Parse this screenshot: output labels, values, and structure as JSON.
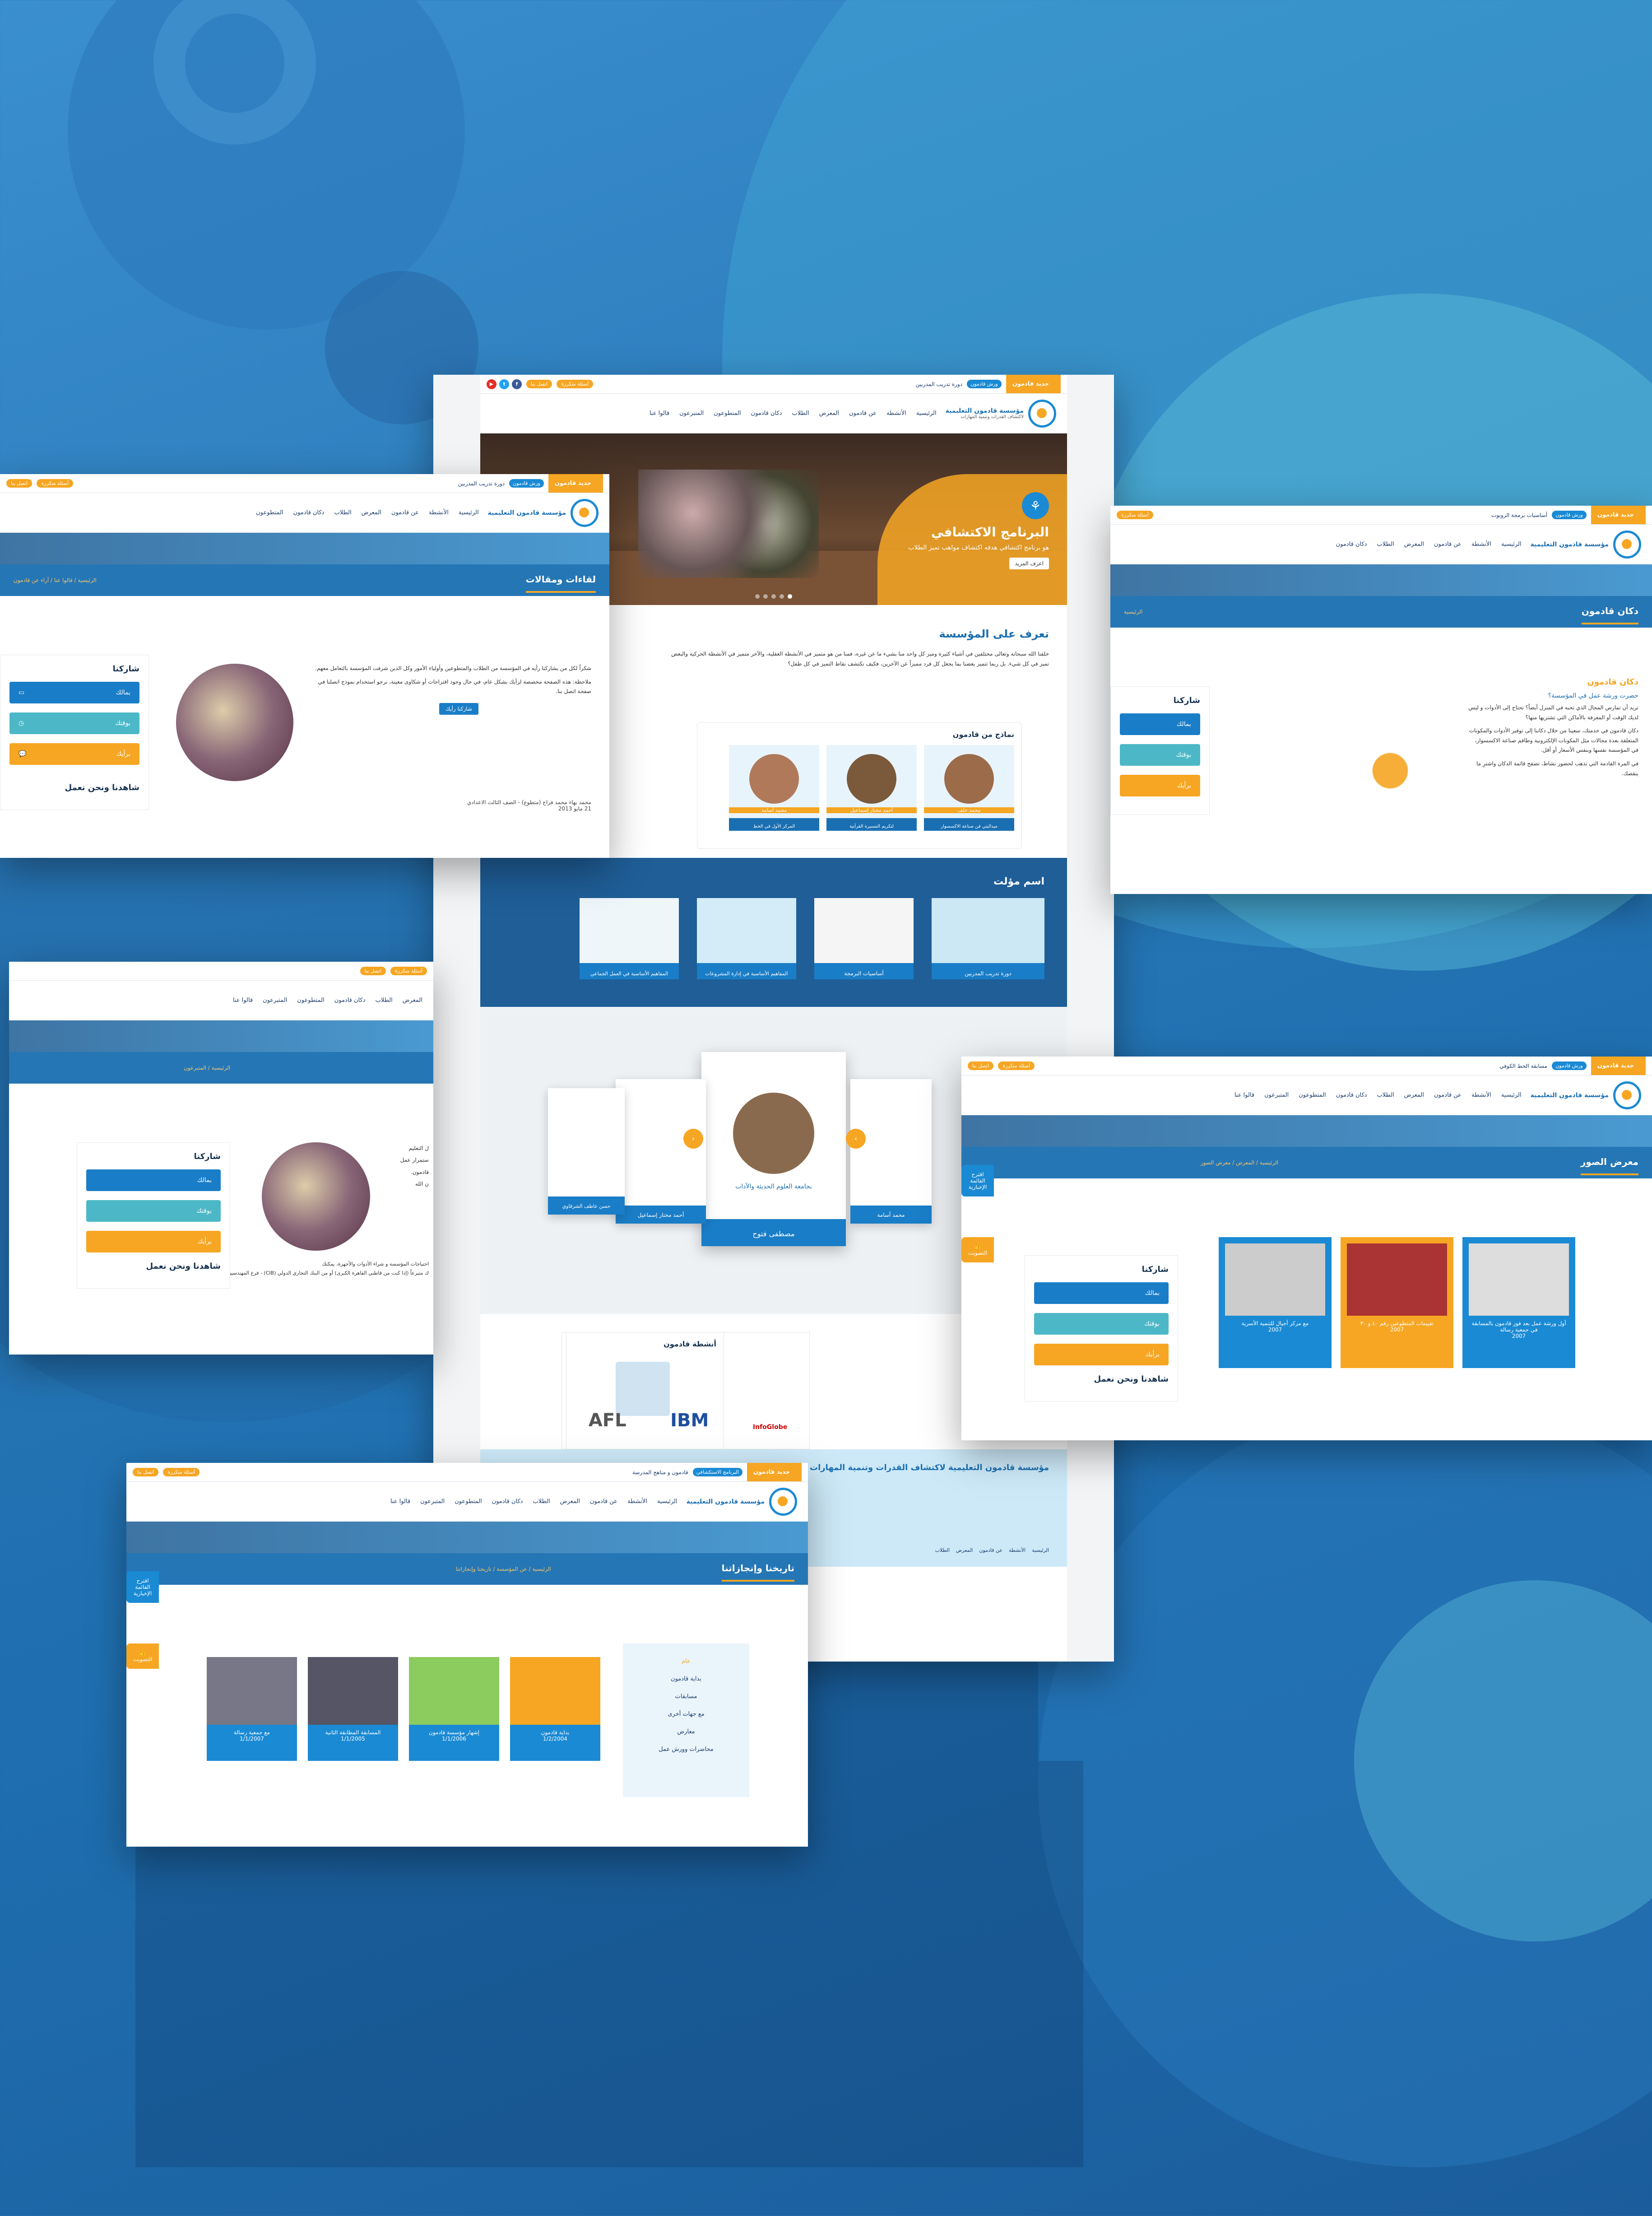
{
  "brand": {
    "name": "مؤسسة قادمون التعليمية",
    "tagline": "لاكتشاف القدرات وتنمية المهارات"
  },
  "topbar": {
    "news_label": "جديد قادمون",
    "faq_label": "أسئلة متكررة",
    "contact_label": "اتصل بنا",
    "tickers": [
      "ورش قادمون",
      "دورة تدريب المدربين",
      "أساسيات برمجة الروبوت",
      "مسابقة الخط الكوفي",
      "البرنامج الاستكشافي",
      "قادمون و مناهج المدرسة"
    ]
  },
  "menu": [
    "الرئيسية",
    "الأنشطة",
    "عن قادمون",
    "المعرض",
    "الطلاب",
    "دكان قادمون",
    "المتطوعون",
    "المتبرعون",
    "قالوا عنا"
  ],
  "hero": {
    "title": "البرنامج الاكتشافي",
    "text": "هو برنامج اكتشافي هدفه اكتشاف مواهب تميز الطلاب",
    "more": "اعرف المزيد"
  },
  "about": {
    "title": "تعرف على المؤسسة",
    "text": "خلقنا الله سبحانه وتعالى مختلفين في أشياء كثيرة وميز كل واحد منا بشيء ما عن غيره، فمنا من هو متميز في الأنشطة العقلية، والآخر متميز في الأنشطة الحركية والبعض تميز في كل شيء. بل ربما تتميز بعضنا بما يجعل كل فرد مميزاً عن الآخرين، فكيف نكتشف نقاط التميز في كل طفل؟"
  },
  "models": {
    "title": "نماذج من قادمون",
    "items": [
      {
        "name": "محمد خلف",
        "caption": "ميداليتي فن صناعة الاكسسوار"
      },
      {
        "name": "أحمد مختار إسماعيل",
        "caption": "لتكريم المسيرة القرآنية"
      },
      {
        "name": "محمد أسامة",
        "caption": "المركز الأول في الخط"
      }
    ]
  },
  "workshops": {
    "title": "اسم مؤلت",
    "items": [
      "دورة تدريب المدربين",
      "أساسيات البرمجة",
      "المفاهيم الأساسية في إدارة المشروعات",
      "المفاهيم الأساسية في العمل الجماعي"
    ]
  },
  "carousel": {
    "center_name": "مصطفى فتوح",
    "center_caption": "بجامعة العلوم الحديثة والآداب",
    "names": [
      "محمد أسامة",
      "حسن عاطف",
      "أحمد مختار إسماعيل",
      "حسن عاطف الشرقاوي"
    ]
  },
  "activities_title": "أنشطة قادمون",
  "partners": [
    "IBM",
    "InfoGlobe",
    "AFL"
  ],
  "footer": {
    "title": "مؤسسة قادمون التعليمية لاكتشاف القدرات وتنمية المهارات",
    "links": [
      "الرئيسية",
      "الأنشطة",
      "عن قادمون",
      "المعرض",
      "الطلاب",
      "دكان قادمون",
      "المتطوعون"
    ]
  },
  "sidebar": {
    "share": "شاركنا",
    "b1": "بمالك",
    "b2": "بوقتك",
    "b3": "برأيك",
    "watch": "شاهدنا ونحن نعمل",
    "photos": "صور",
    "video": "الفيديو"
  },
  "articles": {
    "title": "لقاءات ومقالات",
    "crumbs": "الرئيسية / قالوا عنا / آراء عن قادمون",
    "p1": "شكراً لكل من يشاركنا رأيه في المؤسسة من الطلاب والمتطوعين وأولياء الأمور وكل الذين شرفت المؤسسة بالتعامل معهم.",
    "p2": "ملاحظة: هذه الصفحة مخصصة لرأيك بشكل عام، في حال وجود اقتراحات أو شكاوى معينة، نرجو استخدام نموذج اتصلنا في صفحة اتصل بنا.",
    "cta": "شاركنا رأيك",
    "author": "محمد بهاء محمد فراج (متطوع) - الصف الثالث الاعدادي",
    "date": "21 مايو 2013"
  },
  "shop": {
    "title": "دكان قادمون",
    "crumb": "الرئيسية",
    "heading": "دكان قادمون",
    "sub": "حضرت ورشة عمل في المؤسسة؟",
    "p1": "تريد أن تمارس المجال الذي تحبه في المنزل أيضاً؟ تحتاج إلى الأدوات و ليس لديك الوقت أو المعرفة بالأماكن التي تشتريها منها؟",
    "p2": "دكان قادمون في خدمتك، سعينا من خلال دكاننا إلى توفير الأدوات والمكونات المتعلقة بعدة مجالات مثل المكونات الإلكترونية وطاقم صناعة الاكسسوار، في المؤسسة نفسها وبنفس الأسعار أو أقل.",
    "p3": "في المرة القادمة التي تذهب لحضور نشاط، تصفح قائمة الدكان واشترِ ما ينقصك."
  },
  "donors": {
    "crumb": "الرئيسية / المتبرعون",
    "texts": [
      "ل التعليم",
      "ستمرار عمل",
      "قادمون.",
      "ن الله"
    ],
    "note": "احتياجات المؤسسة و شراء الأدوات والأجهزة، يمكنك",
    "note2": "ك متبرعاً (إذا كنت من قاطني القاهرة الكبرى) أو من البنك التجاري الدولي (CIB) - فرع المهندسين"
  },
  "gallery": {
    "title": "معرض الصور",
    "crumbs": "الرئيسية / المعرض / معرض الصور",
    "items": [
      {
        "label": "أول ورشة عمل بعد فوز قادمون بالمسابقة في جمعية رسالة",
        "year": "2007"
      },
      {
        "label": "تقييمات المتطوعين رقم ٤٠ و ٣٠",
        "year": "2007"
      },
      {
        "label": "مع مركز أجيال للتنمية الأسرية",
        "year": "2007"
      }
    ]
  },
  "history": {
    "title": "تاريخنا وإنجازاتنا",
    "crumbs": "الرئيسية / عن المؤسسة / تاريخنا وإنجازاتنا",
    "filters": [
      "عام",
      "بداية قادمون",
      "مسابقات",
      "مع جهات أخرى",
      "معارض",
      "محاضرات وورش عمل"
    ],
    "items": [
      {
        "label": "بداية قادمون",
        "date": "1/2/2004"
      },
      {
        "label": "إشهار مؤسسة قادمون",
        "date": "1/1/2006"
      },
      {
        "label": "المسابقة المطابقة الثانية",
        "date": "1/1/2005"
      },
      {
        "label": "مع جمعية رسالة",
        "date": "1/1/2007"
      }
    ]
  },
  "side_tabs": {
    "suggest": "اقترح القائمة الإخبارية",
    "vote": "التصويت"
  },
  "colors": {
    "primary": "#1a8ad4",
    "accent": "#f6a623",
    "teal": "#4cb8c7",
    "dark": "#16324f"
  }
}
